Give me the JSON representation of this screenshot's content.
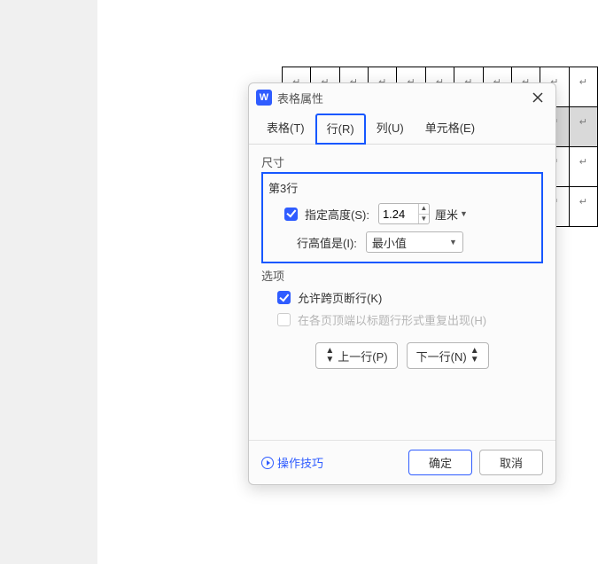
{
  "app_icon_letter": "W",
  "dialog_title": "表格属性",
  "tabs": {
    "table": "表格(T)",
    "row": "行(R)",
    "column": "列(U)",
    "cell": "单元格(E)"
  },
  "section_size": "尺寸",
  "row_label": "第3行",
  "spec_height_label": "指定高度(S):",
  "spec_height_value": "1.24",
  "unit_label": "厘米",
  "height_is_label": "行高值是(I):",
  "height_is_value": "最小值",
  "section_options": "选项",
  "allow_break_label": "允许跨页断行(K)",
  "repeat_header_label": "在各页顶端以标题行形式重复出现(H)",
  "prev_row_label": "上一行(P)",
  "next_row_label": "下一行(N)",
  "tips_label": "操作技巧",
  "ok_label": "确定",
  "cancel_label": "取消",
  "cell_mark": "↵"
}
